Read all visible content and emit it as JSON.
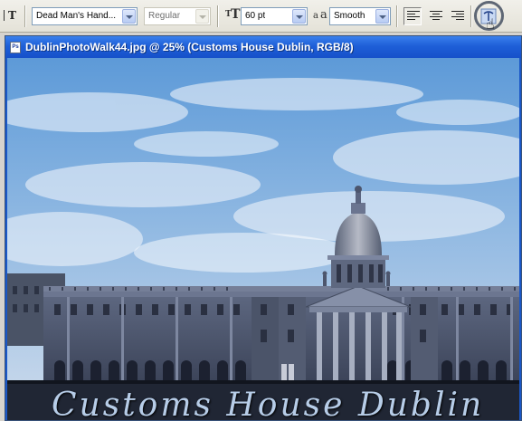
{
  "toolbar": {
    "tool_icon": "text-orientation-icon",
    "font_family": "Dead Man's Hand...",
    "font_style": "Regular",
    "font_size_icon": "font-size-icon",
    "font_size": "60 pt",
    "antialias_icon": "antialias-icon",
    "antialias": "Smooth",
    "align_left_icon": "align-left-icon",
    "align_center_icon": "align-center-icon",
    "align_right_icon": "align-right-icon",
    "warp_text_icon": "warp-text-icon",
    "highlight_color": "#5e6775"
  },
  "document": {
    "title": "DublinPhotoWalk44.jpg @ 25% (Customs House Dublin, RGB/8)",
    "icon_label": "Ps",
    "canvas_text": "Customs House Dublin",
    "title_bar_color": "#1e5fd8"
  }
}
